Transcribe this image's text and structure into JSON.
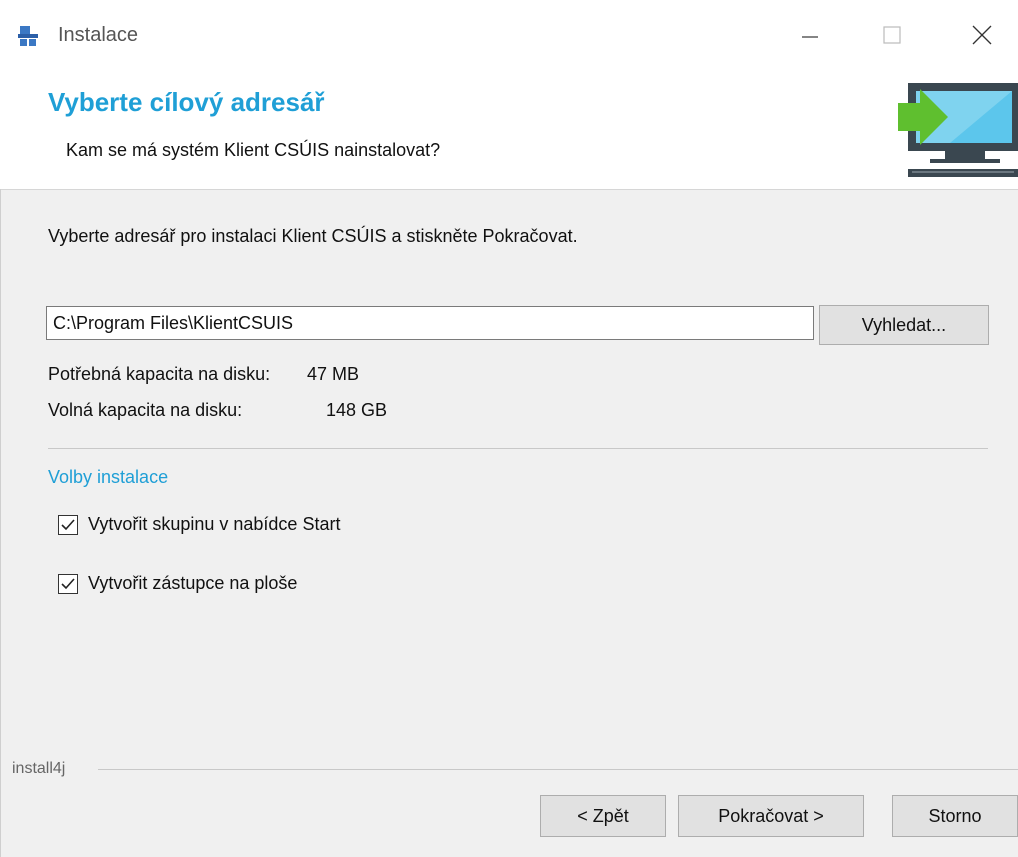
{
  "window": {
    "title": "Instalace"
  },
  "header": {
    "title": "Vyberte cílový adresář",
    "subtitle": "Kam se má systém Klient CSÚIS nainstalovat?"
  },
  "body": {
    "description": "Vyberte adresář pro instalaci Klient CSÚIS a stiskněte Pokračovat.",
    "path_value": "C:\\Program Files\\KlientCSUIS",
    "browse_label": "Vyhledat...",
    "required_label": "Potřebná kapacita na disku:",
    "required_value": "47 MB",
    "free_label": "Volná kapacita na disku:",
    "free_value": "148 GB",
    "options_group": "Volby instalace",
    "options": [
      {
        "label": "Vytvořit skupinu v nabídce Start",
        "checked": true
      },
      {
        "label": "Vytvořit zástupce na ploše",
        "checked": true
      }
    ]
  },
  "footer": {
    "brand": "install4j",
    "back_label": "< Zpět",
    "next_label": "Pokračovat >",
    "cancel_label": "Storno"
  },
  "colors": {
    "accent": "#1f9fd6",
    "arrow_green": "#5fbf2f",
    "monitor_dark": "#3a4750",
    "screen_blue": "#7fd3ef"
  },
  "icons": {
    "app": "installer-icon",
    "minimize": "minimize-icon",
    "maximize": "maximize-icon",
    "close": "close-icon",
    "header": "monitor-arrow-icon",
    "check": "checkmark-icon"
  }
}
